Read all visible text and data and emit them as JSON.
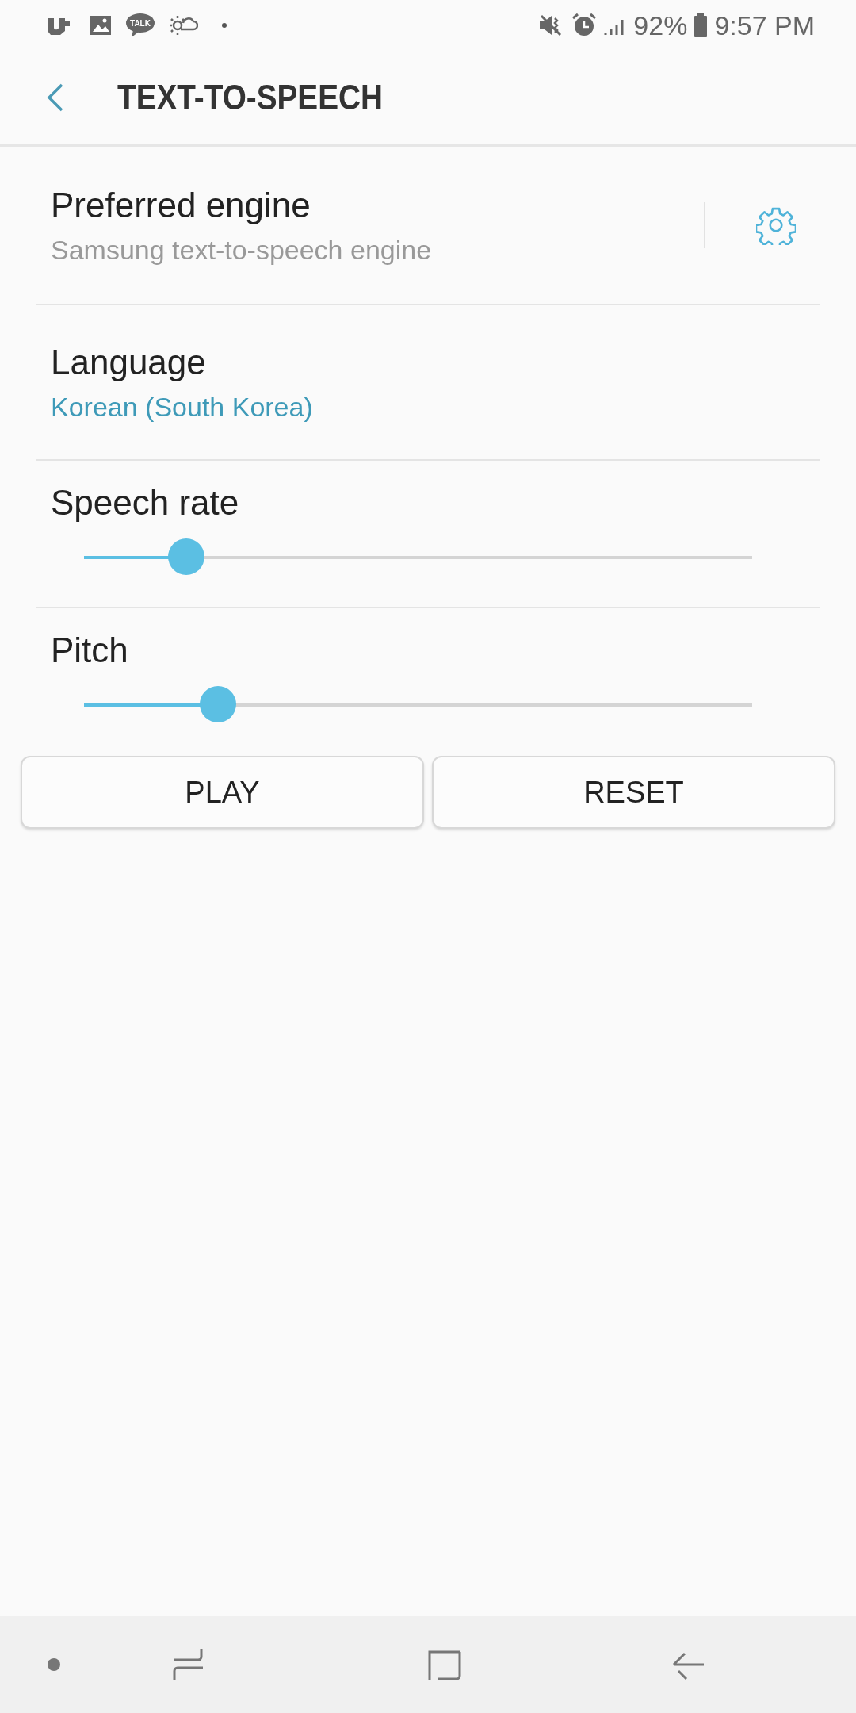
{
  "status_bar": {
    "talk_label": "TALK",
    "battery": "92%",
    "time": "9:57 PM"
  },
  "header": {
    "title": "TEXT-TO-SPEECH"
  },
  "engine": {
    "title": "Preferred engine",
    "value": "Samsung text-to-speech engine"
  },
  "language": {
    "title": "Language",
    "value": "Korean (South Korea)"
  },
  "sliders": [
    {
      "label": "Speech rate",
      "level": 0.153
    },
    {
      "label": "Pitch",
      "level": 0.2
    }
  ],
  "buttons": [
    "PLAY",
    "RESET"
  ]
}
